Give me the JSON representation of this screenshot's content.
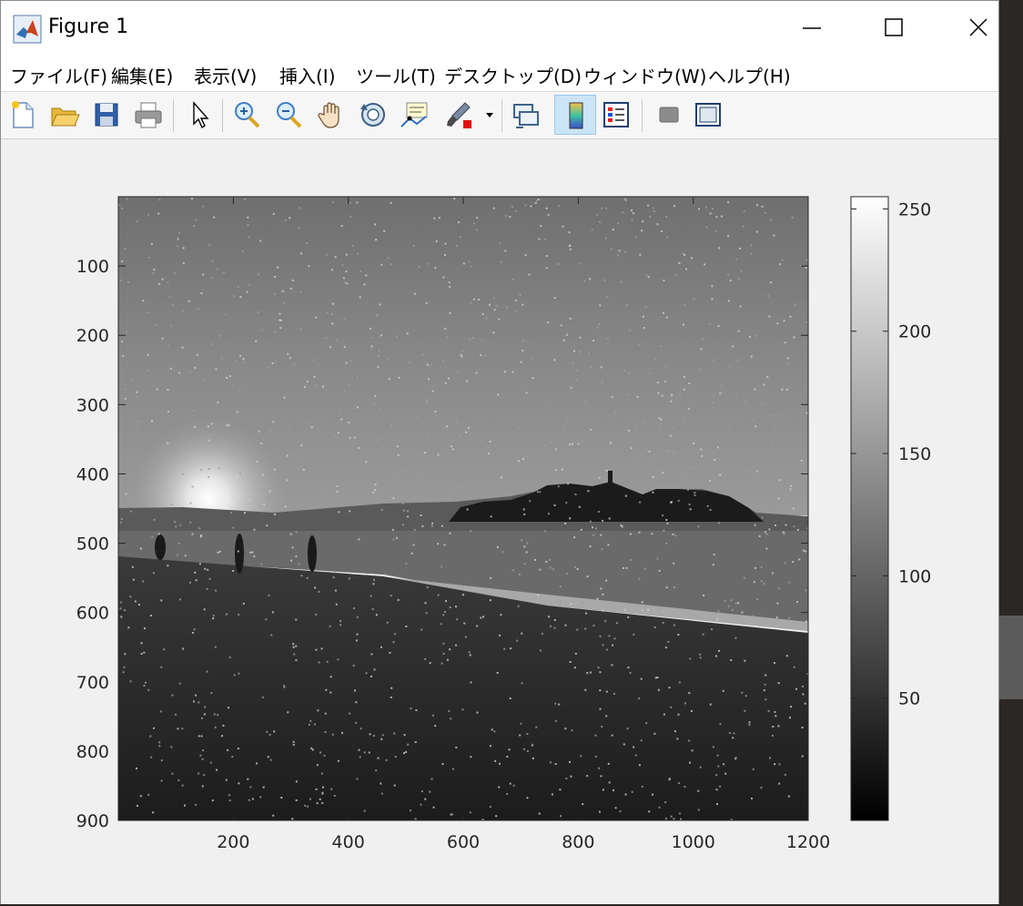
{
  "window": {
    "title": "Figure 1",
    "controls": {
      "minimize": "minimize",
      "maximize": "maximize",
      "close": "close"
    }
  },
  "menu": [
    {
      "label": "ファイル(F)"
    },
    {
      "label": "編集(E)"
    },
    {
      "label": "表示(V)"
    },
    {
      "label": "挿入(I)"
    },
    {
      "label": "ツール(T)"
    },
    {
      "label": "デスクトップ(D)"
    },
    {
      "label": "ウィンドウ(W)"
    },
    {
      "label": "ヘルプ(H)"
    }
  ],
  "toolbar": [
    {
      "icon": "new-figure-icon"
    },
    {
      "icon": "open-folder-icon"
    },
    {
      "icon": "save-icon"
    },
    {
      "icon": "print-icon"
    },
    {
      "icon": "pointer-icon"
    },
    {
      "icon": "zoom-in-icon"
    },
    {
      "icon": "zoom-out-icon"
    },
    {
      "icon": "pan-hand-icon"
    },
    {
      "icon": "rotate-3d-icon"
    },
    {
      "icon": "data-cursor-icon"
    },
    {
      "icon": "brush-icon"
    },
    {
      "icon": "link-plot-icon"
    },
    {
      "icon": "colorbar-icon",
      "active": true
    },
    {
      "icon": "legend-icon"
    },
    {
      "icon": "hide-plot-tools-icon"
    },
    {
      "icon": "show-plot-tools-icon"
    }
  ],
  "image_axes": {
    "x_ticks": [
      "200",
      "400",
      "600",
      "800",
      "1000",
      "1200"
    ],
    "y_ticks": [
      "100",
      "200",
      "300",
      "400",
      "500",
      "600",
      "700",
      "800",
      "900"
    ],
    "x_range": [
      0,
      1200
    ],
    "y_range": [
      0,
      900
    ],
    "colormap": "gray"
  },
  "colorbar": {
    "ticks": [
      "50",
      "100",
      "150",
      "200",
      "250"
    ],
    "range": [
      0,
      255
    ]
  }
}
